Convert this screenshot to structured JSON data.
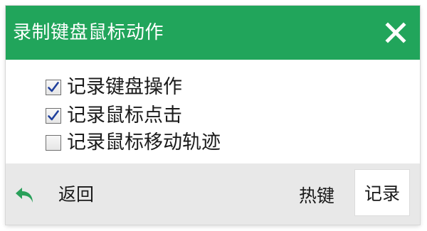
{
  "window": {
    "title": "录制键盘鼠标动作",
    "close_icon": "close-icon"
  },
  "options": [
    {
      "label": "记录键盘操作",
      "checked": true
    },
    {
      "label": "记录鼠标点击",
      "checked": true
    },
    {
      "label": "记录鼠标移动轨迹",
      "checked": false
    }
  ],
  "footer": {
    "back_label": "返回",
    "back_icon": "back-arrow-icon",
    "hotkey_label": "热键",
    "record_label": "记录"
  },
  "colors": {
    "title_bar": "#21a55b",
    "back_icon": "#2aa05a",
    "checkmark": "#1f3f9c",
    "footer_bg": "#e8e8e8"
  }
}
